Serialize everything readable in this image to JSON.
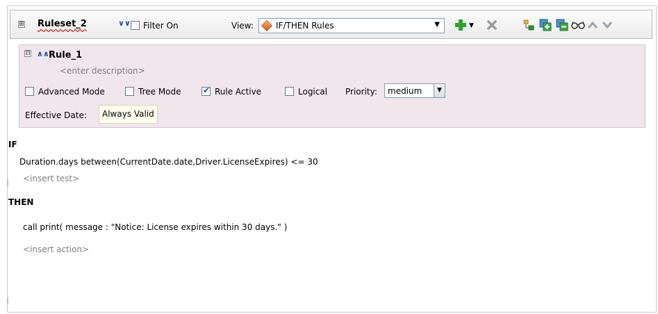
{
  "ruleset": {
    "name": "Ruleset_2",
    "filter_label": "Filter On",
    "view_label": "View:",
    "view_value": "IF/THEN Rules"
  },
  "toolbar_icons": [
    "add-icon",
    "dropdown-arrow-icon",
    "delete-icon",
    "tree-icon",
    "copy-icon",
    "paste-icon",
    "glasses-icon",
    "move-up-icon",
    "move-down-icon"
  ],
  "rule": {
    "name": "Rule_1",
    "description_placeholder": "<enter description>",
    "advanced_mode_label": "Advanced Mode",
    "advanced_mode_checked": false,
    "tree_mode_label": "Tree Mode",
    "tree_mode_checked": false,
    "rule_active_label": "Rule Active",
    "rule_active_checked": true,
    "logical_label": "Logical",
    "logical_checked": false,
    "priority_label": "Priority:",
    "priority_value": "medium",
    "effective_date_label": "Effective Date:",
    "effective_date_value": "Always Valid"
  },
  "if_section": {
    "keyword": "IF",
    "test": "Duration.days between(CurrentDate.date,Driver.LicenseExpires)  <=  30",
    "insert_test": "<insert test>"
  },
  "then_section": {
    "keyword": "THEN",
    "action": "call print( message : \"Notice: License expires within 30 days.\" )",
    "insert_action": "<insert action>"
  },
  "colors": {
    "rule_panel_bg": "#f1e6ec",
    "accent_blue": "#1d4fa8",
    "add_green": "#2aa52a",
    "delete_gray": "#9a9a9a"
  }
}
